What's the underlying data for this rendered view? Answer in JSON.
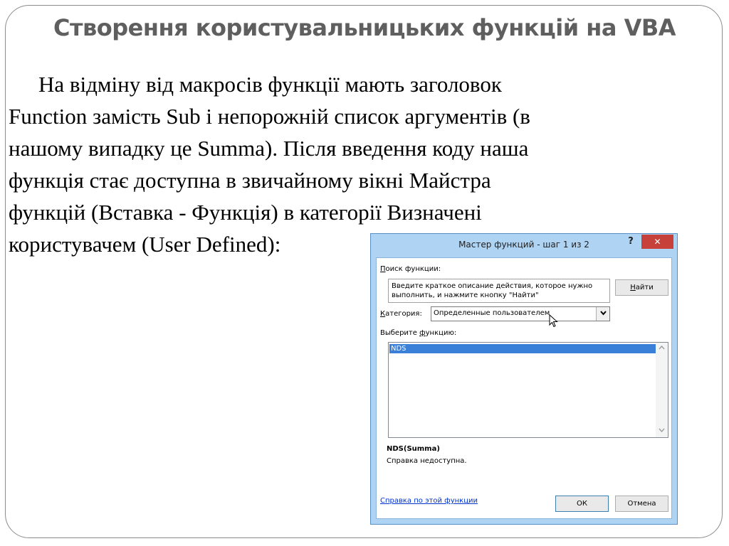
{
  "slide": {
    "title": "Створення користувальницьких функцій на VBA",
    "paragraph": {
      "line1": "На  відміну від макросів функції мають заголовок",
      "line2": "Function замість Sub і непорожній список аргументів (в",
      "line3": "нашому випадку це Summa). Після введення коду наша",
      "line4": "функція стає доступна в звичайному вікні Майстра",
      "line5": "функцій (Вставка - Функція) в категорії Визначені",
      "line6": "користувачем (User Defined):"
    }
  },
  "dialog": {
    "title": "Мастер функций - шаг 1 из 2",
    "help_glyph": "?",
    "close_glyph": "✕",
    "search_label_prefix": "П",
    "search_label_rest": "оиск функции:",
    "search_text": "Введите краткое описание действия, которое нужно выполнить, и нажмите кнопку \"Найти\"",
    "find_button_prefix": "Н",
    "find_button_rest": "айти",
    "category_label_prefix": "К",
    "category_label_rest": "атегория:",
    "category_value": "Определенные пользователем",
    "select_function_label_start": "Выберите ",
    "select_function_label_u": "ф",
    "select_function_label_end": "ункцию:",
    "functions": [
      "NDS"
    ],
    "signature": "NDS(Summa)",
    "description": "Справка недоступна.",
    "help_link": "Справка по этой функции",
    "ok_label": "ОК",
    "cancel_label": "Отмена",
    "colors": {
      "frame": "#afd3f3",
      "close_button": "#c7413a",
      "selection": "#3a80d8",
      "link": "#0033cc"
    },
    "icons": [
      "help-icon",
      "close-icon",
      "dropdown-arrow-icon",
      "mouse-cursor-icon",
      "scroll-up-icon",
      "scroll-down-icon"
    ]
  }
}
